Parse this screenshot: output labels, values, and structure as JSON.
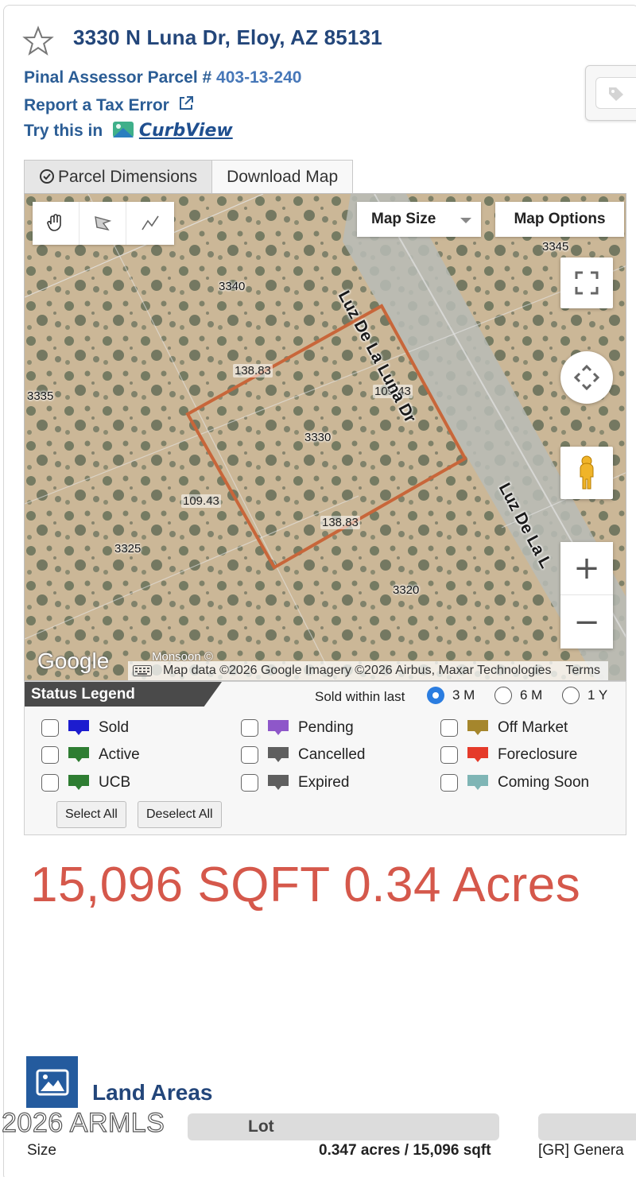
{
  "header": {
    "title": "3330 N Luna Dr, Eloy, AZ 85131",
    "assessor_label": "Pinal Assessor Parcel #",
    "assessor_number": "403-13-240",
    "tax_error_label": "Report a Tax Error",
    "try_label": "Try this in",
    "curbview_label": "CurbView"
  },
  "tabs": [
    {
      "label": "Parcel Dimensions",
      "icon": "check-circle-icon",
      "active": true
    },
    {
      "label": "Download Map",
      "active": false
    }
  ],
  "map": {
    "map_size_label": "Map Size",
    "map_options_label": "Map Options",
    "parcel_numbers": [
      "3345",
      "3340",
      "3335",
      "3330",
      "3325",
      "3320"
    ],
    "dimensions": [
      "138.83",
      "109.43",
      "109.43",
      "138.83"
    ],
    "street_name_1": "Luz De La Luna Dr",
    "street_name_2": "Luz De La L",
    "google_label": "Google",
    "watermark": "Monsoon ©",
    "attribution": "Map data ©2026 Google Imagery ©2026 Airbus, Maxar Technologies",
    "terms_label": "Terms",
    "parcel_outline_color": "#c8663a"
  },
  "legend": {
    "title": "Status Legend",
    "sold_within_label": "Sold within last",
    "periods": [
      {
        "label": "3 M",
        "selected": true
      },
      {
        "label": "6 M",
        "selected": false
      },
      {
        "label": "1 Y",
        "selected": false
      }
    ],
    "items": [
      {
        "label": "Sold",
        "color": "#1c1ccf"
      },
      {
        "label": "Active",
        "color": "#2e7d32"
      },
      {
        "label": "UCB",
        "color": "#2e7d32"
      },
      {
        "label": "Pending",
        "color": "#8e57c9"
      },
      {
        "label": "Cancelled",
        "color": "#5f5f5f"
      },
      {
        "label": "Expired",
        "color": "#5f5f5f"
      },
      {
        "label": "Off Market",
        "color": "#a5862c"
      },
      {
        "label": "Foreclosure",
        "color": "#e53a2a"
      },
      {
        "label": "Coming Soon",
        "color": "#7fb5b5"
      }
    ],
    "select_all_label": "Select All",
    "deselect_all_label": "Deselect All"
  },
  "area_summary": "15,096 SQFT 0.34 Acres",
  "land_areas": {
    "title": "Land Areas",
    "column_header": "Lot",
    "row_label": "Size",
    "row_value": "0.347 acres / 15,096 sqft",
    "row_extra": "[GR] Genera"
  },
  "copyright": "2026 ARMLS"
}
